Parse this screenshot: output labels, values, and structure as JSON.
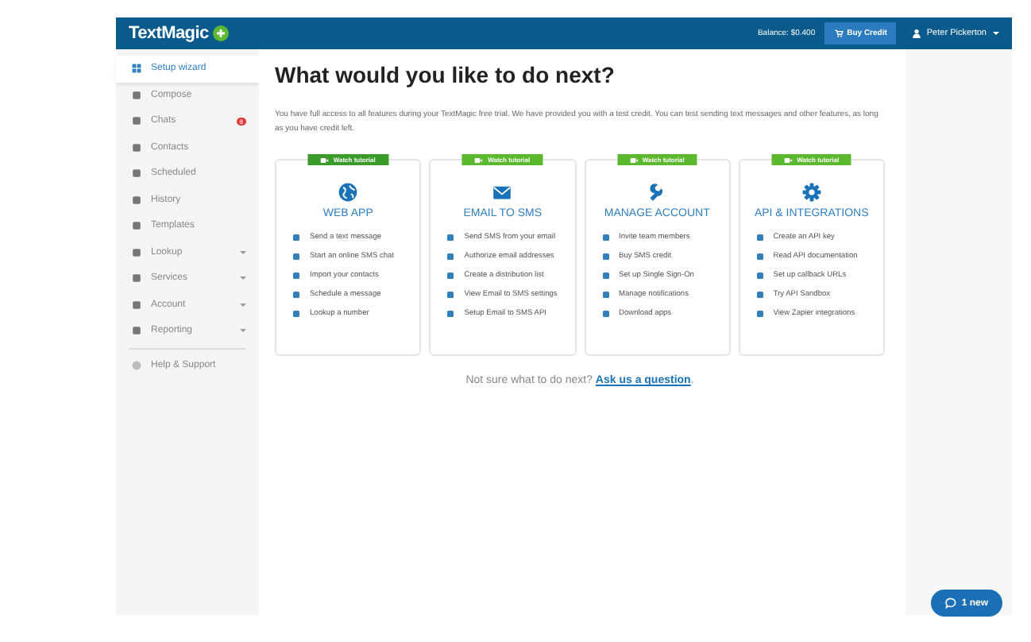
{
  "header": {
    "logo": "TextMagic",
    "balance": "Balance: $0.400",
    "buy_credit": "Buy Credit",
    "user": "Peter Pickerton"
  },
  "sidebar": {
    "items": [
      {
        "label": "Setup wizard",
        "selected": true,
        "expandable": false
      },
      {
        "label": "Compose",
        "selected": false,
        "expandable": false
      },
      {
        "label": "Chats",
        "selected": false,
        "expandable": false,
        "badge": "8"
      },
      {
        "label": "Contacts",
        "selected": false,
        "expandable": false
      },
      {
        "label": "Scheduled",
        "selected": false,
        "expandable": false
      },
      {
        "label": "History",
        "selected": false,
        "expandable": false
      },
      {
        "label": "Templates",
        "selected": false,
        "expandable": false
      },
      {
        "label": "Lookup",
        "selected": false,
        "expandable": true
      },
      {
        "label": "Services",
        "selected": false,
        "expandable": true
      },
      {
        "label": "Account",
        "selected": false,
        "expandable": true
      },
      {
        "label": "Reporting",
        "selected": false,
        "expandable": true
      }
    ],
    "footer_item": "Help & Support"
  },
  "main": {
    "title": "What would you like to do next?",
    "intro": "You have full access to all features during your TextMagic free trial. We have provided you with a test credit. You can test sending text messages and other features, as long as you have credit left.",
    "cards": [
      {
        "tutorial": "Watch tutorial",
        "highlighted": true,
        "kind": "globe",
        "title": "WEB APP",
        "items": [
          "Send a text message",
          "Start an online SMS chat",
          "Import your contacts",
          "Schedule a message",
          "Lookup a number"
        ]
      },
      {
        "tutorial": "Watch tutorial",
        "highlighted": false,
        "kind": "envelope",
        "title": "EMAIL TO SMS",
        "items": [
          "Send SMS from your email",
          "Authorize email addresses",
          "Create a distribution list",
          "View Email to SMS settings",
          "Setup Email to SMS API"
        ]
      },
      {
        "tutorial": "Watch tutorial",
        "highlighted": false,
        "kind": "wrench",
        "title": "MANAGE ACCOUNT",
        "items": [
          "Invite team members",
          "Buy SMS credit",
          "Set up Single Sign-On",
          "Manage notifications",
          "Download apps"
        ]
      },
      {
        "tutorial": "Watch tutorial",
        "highlighted": false,
        "kind": "gear",
        "title": "API & INTEGRATIONS",
        "items": [
          "Create an API key",
          "Read API documentation",
          "Set up callback URLs",
          "Try API Sandbox",
          "View Zapier integrations"
        ]
      }
    ],
    "help_text": "Not sure what to do next?",
    "help_link": "Ask us a question",
    "help_end": "."
  },
  "chat_button": "1 new"
}
